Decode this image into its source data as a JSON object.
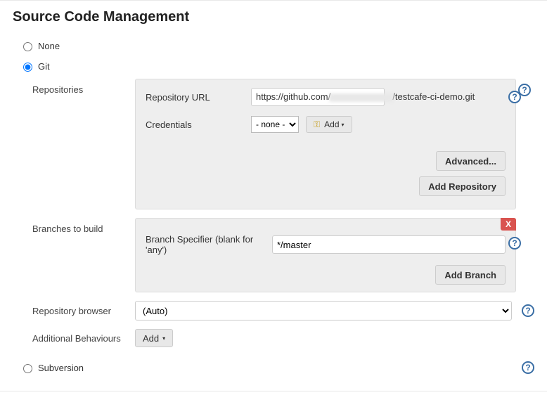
{
  "title": "Source Code Management",
  "scm": {
    "options": {
      "none": "None",
      "git": "Git",
      "subversion": "Subversion"
    },
    "selected": "git"
  },
  "git": {
    "repositories_label": "Repositories",
    "repo_url_label": "Repository URL",
    "repo_url_prefix": "https://github.com/",
    "repo_url_suffix": "/testcafe-ci-demo.git",
    "credentials_label": "Credentials",
    "credentials_selected": "- none -",
    "add_credentials_label": "Add",
    "advanced_label": "Advanced...",
    "add_repo_label": "Add Repository",
    "branches_label": "Branches to build",
    "branch_specifier_label": "Branch Specifier (blank for 'any')",
    "branch_specifier_value": "*/master",
    "add_branch_label": "Add Branch",
    "repo_browser_label": "Repository browser",
    "repo_browser_value": "(Auto)",
    "additional_behaviours_label": "Additional Behaviours",
    "add_behaviour_label": "Add"
  }
}
